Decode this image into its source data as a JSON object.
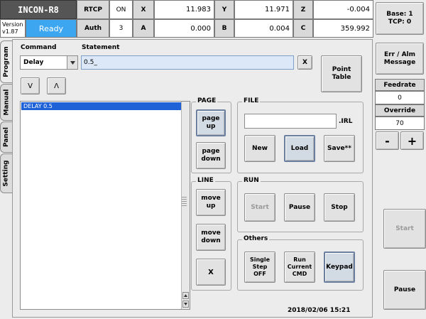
{
  "header": {
    "app_title": "INCON-R8",
    "version_label": "Version",
    "version": "v1.87",
    "status": "Ready",
    "rtcp_label": "RTCP",
    "rtcp_value": "ON",
    "auth_label": "Auth",
    "auth_value": "3",
    "coords": {
      "x_label": "X",
      "x_value": "11.983",
      "y_label": "Y",
      "y_value": "11.971",
      "z_label": "Z",
      "z_value": "-0.004",
      "a_label": "A",
      "a_value": "0.000",
      "b_label": "B",
      "b_value": "0.004",
      "c_label": "C",
      "c_value": "359.992"
    },
    "base_tcp_line1": "Base: 1",
    "base_tcp_line2": "TCP: 0"
  },
  "tabs": [
    "Program",
    "Manual",
    "Panel",
    "Setting"
  ],
  "program": {
    "command_label": "Command",
    "command_value": "Delay",
    "statement_label": "Statement",
    "statement_value": "0.5_",
    "clear_label": "X",
    "point_table_line1": "Point",
    "point_table_line2": "Table",
    "down_label": "V",
    "up_label": "Λ",
    "list_items": [
      "DELAY 0.5"
    ]
  },
  "page": {
    "title": "PAGE",
    "page_up_line1": "page",
    "page_up_line2": "up",
    "page_down_line1": "page",
    "page_down_line2": "down"
  },
  "line": {
    "title": "LINE",
    "move_up_line1": "move",
    "move_up_line2": "up",
    "move_down_line1": "move",
    "move_down_line2": "down",
    "delete_label": "X"
  },
  "file": {
    "title": "FILE",
    "filename_value": "",
    "extension": ".IRL",
    "new_label": "New",
    "load_label": "Load",
    "save_label": "Save**"
  },
  "run": {
    "title": "RUN",
    "start_label": "Start",
    "pause_label": "Pause",
    "stop_label": "Stop"
  },
  "others": {
    "title": "Others",
    "single_step_line1": "Single",
    "single_step_line2": "Step",
    "single_step_line3": "OFF",
    "run_current_line1": "Run",
    "run_current_line2": "Current",
    "run_current_line3": "CMD",
    "keypad_label": "Keypad"
  },
  "datetime": "2018/02/06 15:21",
  "right_panel": {
    "err_alm_line1": "Err / Alm",
    "err_alm_line2": "Message",
    "feedrate_label": "Feedrate",
    "feedrate_value": "0",
    "override_label": "Override",
    "override_value": "70",
    "minus_label": "-",
    "plus_label": "+",
    "start_label": "Start",
    "pause_label": "Pause"
  },
  "colors": {
    "ready_bg": "#3da6f0",
    "title_bg": "#555555",
    "list_selected": "#1f62d8",
    "input_bg": "#dce8f8"
  }
}
